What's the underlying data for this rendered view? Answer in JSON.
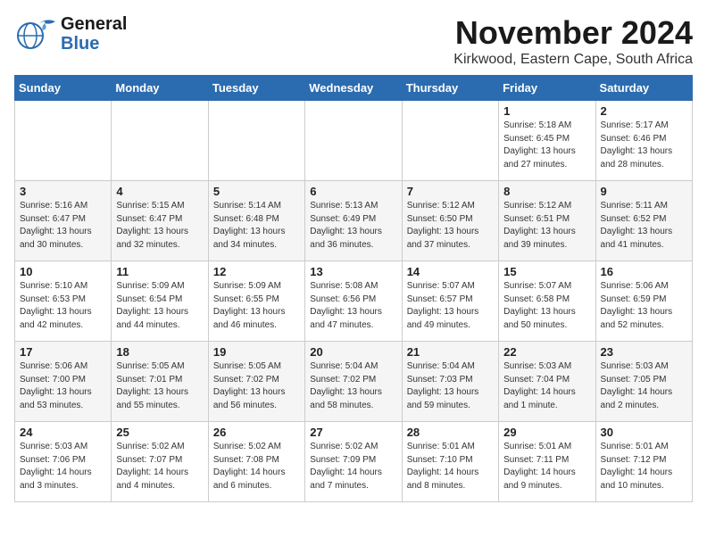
{
  "header": {
    "logo_line1": "General",
    "logo_line2": "Blue",
    "month_title": "November 2024",
    "location": "Kirkwood, Eastern Cape, South Africa"
  },
  "days_of_week": [
    "Sunday",
    "Monday",
    "Tuesday",
    "Wednesday",
    "Thursday",
    "Friday",
    "Saturday"
  ],
  "weeks": [
    [
      {
        "day": "",
        "info": ""
      },
      {
        "day": "",
        "info": ""
      },
      {
        "day": "",
        "info": ""
      },
      {
        "day": "",
        "info": ""
      },
      {
        "day": "",
        "info": ""
      },
      {
        "day": "1",
        "info": "Sunrise: 5:18 AM\nSunset: 6:45 PM\nDaylight: 13 hours\nand 27 minutes."
      },
      {
        "day": "2",
        "info": "Sunrise: 5:17 AM\nSunset: 6:46 PM\nDaylight: 13 hours\nand 28 minutes."
      }
    ],
    [
      {
        "day": "3",
        "info": "Sunrise: 5:16 AM\nSunset: 6:47 PM\nDaylight: 13 hours\nand 30 minutes."
      },
      {
        "day": "4",
        "info": "Sunrise: 5:15 AM\nSunset: 6:47 PM\nDaylight: 13 hours\nand 32 minutes."
      },
      {
        "day": "5",
        "info": "Sunrise: 5:14 AM\nSunset: 6:48 PM\nDaylight: 13 hours\nand 34 minutes."
      },
      {
        "day": "6",
        "info": "Sunrise: 5:13 AM\nSunset: 6:49 PM\nDaylight: 13 hours\nand 36 minutes."
      },
      {
        "day": "7",
        "info": "Sunrise: 5:12 AM\nSunset: 6:50 PM\nDaylight: 13 hours\nand 37 minutes."
      },
      {
        "day": "8",
        "info": "Sunrise: 5:12 AM\nSunset: 6:51 PM\nDaylight: 13 hours\nand 39 minutes."
      },
      {
        "day": "9",
        "info": "Sunrise: 5:11 AM\nSunset: 6:52 PM\nDaylight: 13 hours\nand 41 minutes."
      }
    ],
    [
      {
        "day": "10",
        "info": "Sunrise: 5:10 AM\nSunset: 6:53 PM\nDaylight: 13 hours\nand 42 minutes."
      },
      {
        "day": "11",
        "info": "Sunrise: 5:09 AM\nSunset: 6:54 PM\nDaylight: 13 hours\nand 44 minutes."
      },
      {
        "day": "12",
        "info": "Sunrise: 5:09 AM\nSunset: 6:55 PM\nDaylight: 13 hours\nand 46 minutes."
      },
      {
        "day": "13",
        "info": "Sunrise: 5:08 AM\nSunset: 6:56 PM\nDaylight: 13 hours\nand 47 minutes."
      },
      {
        "day": "14",
        "info": "Sunrise: 5:07 AM\nSunset: 6:57 PM\nDaylight: 13 hours\nand 49 minutes."
      },
      {
        "day": "15",
        "info": "Sunrise: 5:07 AM\nSunset: 6:58 PM\nDaylight: 13 hours\nand 50 minutes."
      },
      {
        "day": "16",
        "info": "Sunrise: 5:06 AM\nSunset: 6:59 PM\nDaylight: 13 hours\nand 52 minutes."
      }
    ],
    [
      {
        "day": "17",
        "info": "Sunrise: 5:06 AM\nSunset: 7:00 PM\nDaylight: 13 hours\nand 53 minutes."
      },
      {
        "day": "18",
        "info": "Sunrise: 5:05 AM\nSunset: 7:01 PM\nDaylight: 13 hours\nand 55 minutes."
      },
      {
        "day": "19",
        "info": "Sunrise: 5:05 AM\nSunset: 7:02 PM\nDaylight: 13 hours\nand 56 minutes."
      },
      {
        "day": "20",
        "info": "Sunrise: 5:04 AM\nSunset: 7:02 PM\nDaylight: 13 hours\nand 58 minutes."
      },
      {
        "day": "21",
        "info": "Sunrise: 5:04 AM\nSunset: 7:03 PM\nDaylight: 13 hours\nand 59 minutes."
      },
      {
        "day": "22",
        "info": "Sunrise: 5:03 AM\nSunset: 7:04 PM\nDaylight: 14 hours\nand 1 minute."
      },
      {
        "day": "23",
        "info": "Sunrise: 5:03 AM\nSunset: 7:05 PM\nDaylight: 14 hours\nand 2 minutes."
      }
    ],
    [
      {
        "day": "24",
        "info": "Sunrise: 5:03 AM\nSunset: 7:06 PM\nDaylight: 14 hours\nand 3 minutes."
      },
      {
        "day": "25",
        "info": "Sunrise: 5:02 AM\nSunset: 7:07 PM\nDaylight: 14 hours\nand 4 minutes."
      },
      {
        "day": "26",
        "info": "Sunrise: 5:02 AM\nSunset: 7:08 PM\nDaylight: 14 hours\nand 6 minutes."
      },
      {
        "day": "27",
        "info": "Sunrise: 5:02 AM\nSunset: 7:09 PM\nDaylight: 14 hours\nand 7 minutes."
      },
      {
        "day": "28",
        "info": "Sunrise: 5:01 AM\nSunset: 7:10 PM\nDaylight: 14 hours\nand 8 minutes."
      },
      {
        "day": "29",
        "info": "Sunrise: 5:01 AM\nSunset: 7:11 PM\nDaylight: 14 hours\nand 9 minutes."
      },
      {
        "day": "30",
        "info": "Sunrise: 5:01 AM\nSunset: 7:12 PM\nDaylight: 14 hours\nand 10 minutes."
      }
    ]
  ]
}
